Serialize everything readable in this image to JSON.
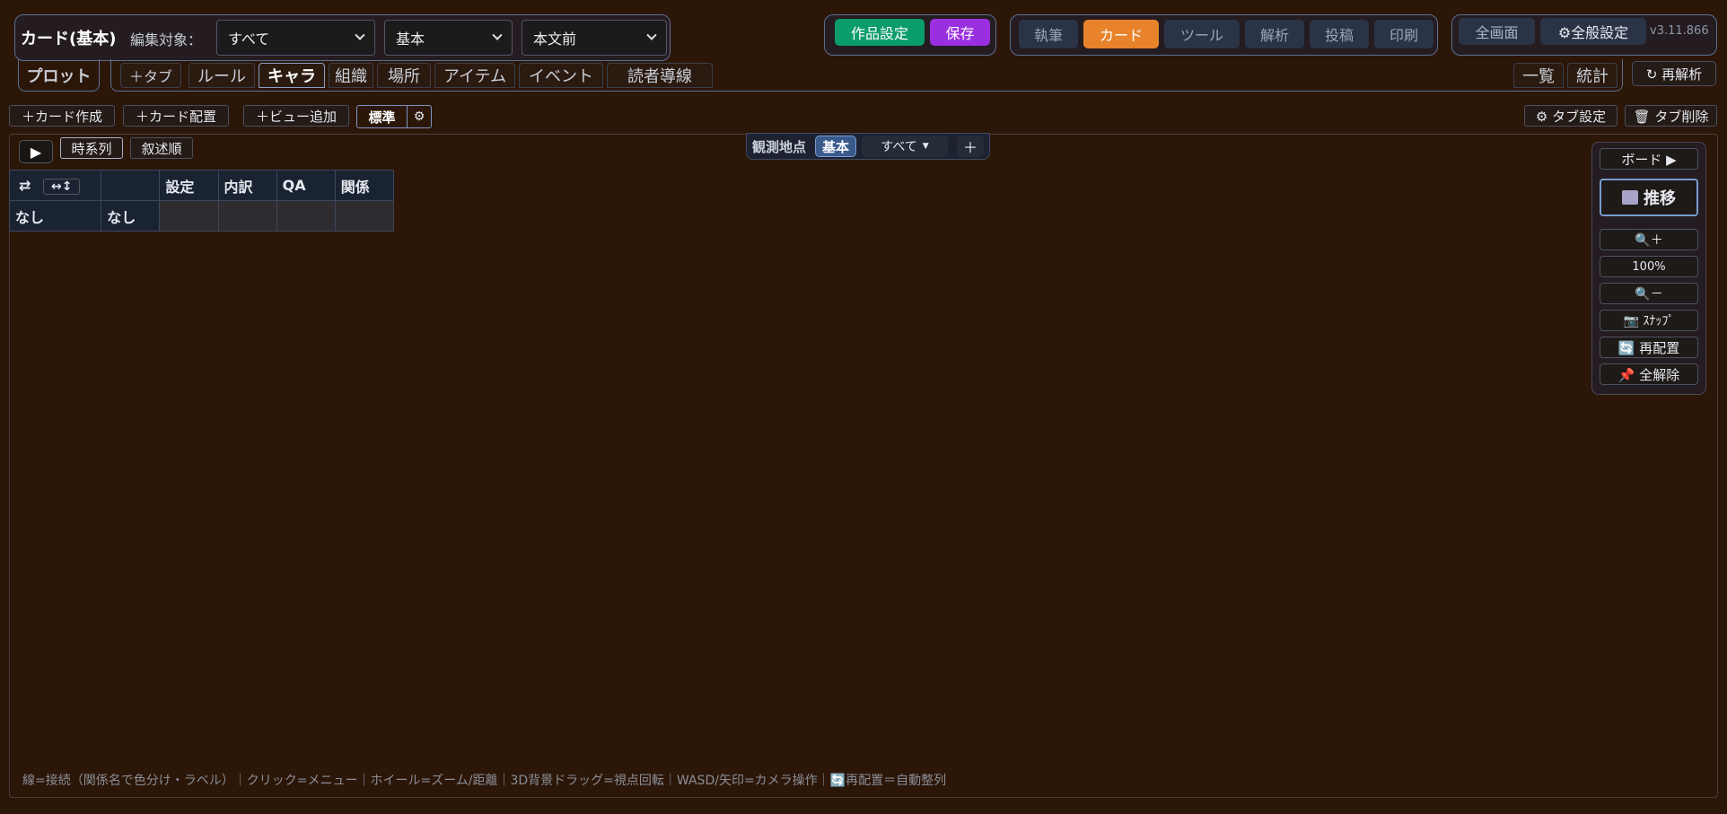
{
  "header": {
    "title": "カード(基本)",
    "edit_target_label": "編集対象：",
    "select_target": "すべて",
    "select_mode": "基本",
    "select_position": "本文前",
    "work_settings": "作品設定",
    "save": "保存",
    "nav": [
      "執筆",
      "カード",
      "ツール",
      "解析",
      "投稿",
      "印刷"
    ],
    "active_nav": "カード",
    "fullscreen": "全画面",
    "general_settings": "⚙全般設定",
    "version": "v3.11.866"
  },
  "tabs": {
    "plot": "プロット",
    "add_tab": "＋タブ",
    "items": [
      "ルール",
      "キャラ",
      "組織",
      "場所",
      "アイテム",
      "イベント",
      "読者導線"
    ],
    "active": "キャラ",
    "list": "一覧",
    "stats": "統計",
    "reanalyze": "↻ 再解析"
  },
  "toolbar": {
    "create_card": "＋カード作成",
    "place_card": "＋カード配置",
    "add_view": "＋ビュー追加",
    "view_standard": "標準",
    "view_gear": "⚙",
    "tab_settings": "⚙ タブ設定",
    "tab_delete": "🗑 タブ削除"
  },
  "board": {
    "play": "▶",
    "chronological": "時系列",
    "narrative_order": "叙述順",
    "observation_label": "観測地点",
    "observation_mode": "基本",
    "observation_filter": "すべて",
    "observation_add": "＋",
    "table": {
      "header_icons": [
        "⇄",
        "↔↕"
      ],
      "columns": [
        "設定",
        "内訳",
        "QA",
        "関係"
      ],
      "row": [
        "なし",
        "なし"
      ]
    },
    "hint": "線=接続（関係名で色分け・ラベル）｜クリック=メニュー｜ホイール=ズーム/距離｜3D背景ドラッグ=視点回転｜WASD/矢印=カメラ操作｜🔄再配置＝自動整列"
  },
  "side_panel": {
    "board": "ボード ▶",
    "transition": "推移",
    "zoom_in": "🔍＋",
    "zoom_level": "100%",
    "zoom_out": "🔍－",
    "snap": "📷 ｽﾅｯﾌﾟ",
    "rearrange": "🔄 再配置",
    "clear_all": "📌 全解除"
  },
  "colors": {
    "background": "#2c1608",
    "accent_orange": "#e8832b",
    "work_settings_green": "#0a9c6a",
    "save_purple": "#9a2fe0"
  }
}
